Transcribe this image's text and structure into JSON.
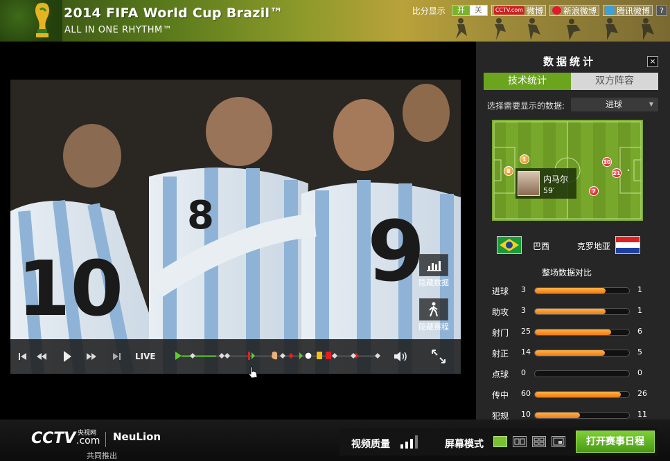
{
  "header": {
    "title": "2014 FIFA World Cup Brazil™",
    "subtitle": "ALL IN ONE RHYTHM™",
    "score_display_label": "比分显示",
    "toggle_on": "开",
    "toggle_off": "关",
    "share": [
      {
        "name": "cctv-weibo",
        "label": "微博",
        "brand": "CCTV.com",
        "color": "#cc2222"
      },
      {
        "name": "sina-weibo",
        "label": "新浪微博",
        "color": "#e6162d"
      },
      {
        "name": "tencent-weibo",
        "label": "腾讯微博",
        "color": "#3aa1db"
      }
    ],
    "help": "?"
  },
  "player": {
    "live_label": "LIVE",
    "hide_stats_label": "隐藏数据",
    "hide_schedule_label": "隐藏赛程"
  },
  "panel": {
    "title": "数据统计",
    "close": "×",
    "tabs": [
      {
        "label": "技术统计",
        "active": true
      },
      {
        "label": "双方阵容",
        "active": false
      }
    ],
    "select_label": "选择需要显示的数据:",
    "select_value": "进球",
    "pitch_markers": [
      {
        "number": "1",
        "style": "orange"
      },
      {
        "number": "8",
        "style": "orange"
      },
      {
        "number": "10",
        "style": "red"
      },
      {
        "number": "21",
        "style": "red"
      },
      {
        "number": "7",
        "style": "red"
      }
    ],
    "player_card": {
      "name": "内马尔",
      "minute": "59′"
    },
    "team_a": "巴西",
    "team_b": "克罗地亚",
    "comparison_title": "整场数据对比",
    "stats": [
      {
        "label": "进球",
        "a": 3,
        "b": 1,
        "fill": 0.75
      },
      {
        "label": "助攻",
        "a": 3,
        "b": 1,
        "fill": 0.75
      },
      {
        "label": "射门",
        "a": 25,
        "b": 6,
        "fill": 0.81
      },
      {
        "label": "射正",
        "a": 14,
        "b": 5,
        "fill": 0.74
      },
      {
        "label": "点球",
        "a": 0,
        "b": 0,
        "fill": 0
      },
      {
        "label": "传中",
        "a": 60,
        "b": 26,
        "fill": 0.91
      },
      {
        "label": "犯规",
        "a": 10,
        "b": 11,
        "fill": 0.48
      }
    ]
  },
  "footer": {
    "cctv": "CCTV",
    "cctv_cn": "央视网",
    "cctv_com": ".com",
    "neulion": "NeuLion",
    "jointly": "共同推出",
    "quality_label": "视频质量",
    "mode_label": "屏幕模式",
    "schedule_button": "打开赛事日程"
  },
  "colors": {
    "accent": "#6aa51d",
    "bar": "#f08a1a"
  }
}
